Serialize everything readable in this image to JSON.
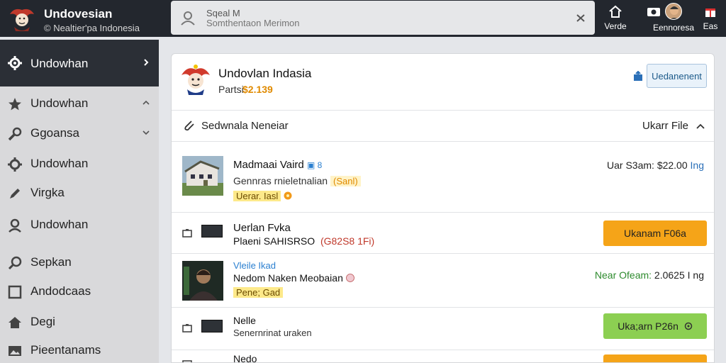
{
  "brand": {
    "title": "Undovesian",
    "subtitle": "© Nealtier'pa Indonesia"
  },
  "search": {
    "label": "Sqeal M",
    "placeholder": "Somthentaon Merimon"
  },
  "top_actions": [
    {
      "label": "Verde",
      "icon": "home-icon"
    },
    {
      "label": "Eennoresa",
      "icon": "camera-icon"
    },
    {
      "label": "Eas",
      "icon": "gift-icon"
    }
  ],
  "sidebar": {
    "items": [
      {
        "label": "Undowhan",
        "icon": "gear-icon",
        "active": true,
        "chevron": "right"
      },
      {
        "label": "Undowhan",
        "icon": "star-icon",
        "chevron": "up"
      },
      {
        "label": "Ggoansa",
        "icon": "wrench-icon",
        "chevron": "down"
      },
      {
        "label": "Undowhan",
        "icon": "gear-icon"
      },
      {
        "label": "Virgka",
        "icon": "pen-icon"
      },
      {
        "label": "Undowhan",
        "icon": "user-icon"
      },
      {
        "label": "Sepkan",
        "icon": "search-icon"
      },
      {
        "label": "Andodcaas",
        "icon": "square-icon"
      },
      {
        "label": "Degi",
        "icon": "home-icon"
      },
      {
        "label": "Pieentanams",
        "icon": "image-icon"
      }
    ]
  },
  "panel": {
    "title": "Undovlan Indasia",
    "price_label": "Partsi",
    "price_value": "$2.139",
    "button_label": "Uedanenent"
  },
  "section": {
    "title": "Sedwnala Neneiar",
    "action_label": "Ukarr File"
  },
  "rows": [
    {
      "title": "Madmaai Vaird",
      "title_badge": "▣ 8",
      "subtitle": "Gennras rnieletnalian",
      "subtitle_tag": "(Sanl)",
      "tag": "Uerar. Iasl",
      "price_label": "Uar S3am:",
      "price_value": "$22.00",
      "price_unit": "Ing"
    },
    {
      "title": "Uerlan Fvka",
      "subtitle": "Plaeni SAHISRSO",
      "meta": "(G82S8 1Fi)",
      "button": "Ukanam F06a"
    },
    {
      "link": "Vleile Ikad",
      "title": "Nedom Naken Meobaian",
      "tag": "Pene; Gad",
      "price_label": "Near Ofeam:",
      "price_value": "2.0625 I",
      "price_unit": "ng"
    },
    {
      "title": "Nelle",
      "subtitle": "Senernrinat uraken",
      "button": "Uka;arn P26n"
    },
    {
      "title": "Nedo",
      "button": ""
    }
  ],
  "colors": {
    "topbar": "#23272e",
    "accent_orange": "#f5a418",
    "accent_green": "#8ccf52",
    "price_gold": "#e08a00"
  }
}
